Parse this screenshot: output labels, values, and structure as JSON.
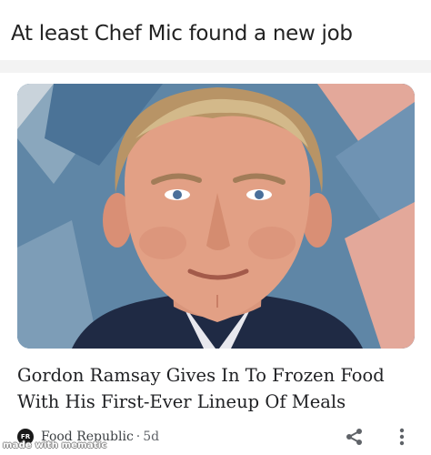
{
  "meme": {
    "caption": "At least Chef Mic found a new job",
    "watermark": "made with mematic"
  },
  "article": {
    "headline_line1": "Gordon Ramsay Gives In To Frozen Food",
    "headline_line2": "With His First-Ever Lineup Of Meals",
    "source_logo_text": "FR",
    "source_name": "Food Republic",
    "separator": "·",
    "age": "5d",
    "image_subject": "portrait photo of a man with swept-back blond hair in a dark suit in front of a blue and pink patterned backdrop"
  },
  "colors": {
    "backdrop_blue": "#5f86a6",
    "backdrop_pink": "#e3a89a",
    "text_dark": "#202124",
    "text_muted": "#5f6368"
  },
  "icons": {
    "share": "share-icon",
    "more": "more-vert-icon"
  }
}
